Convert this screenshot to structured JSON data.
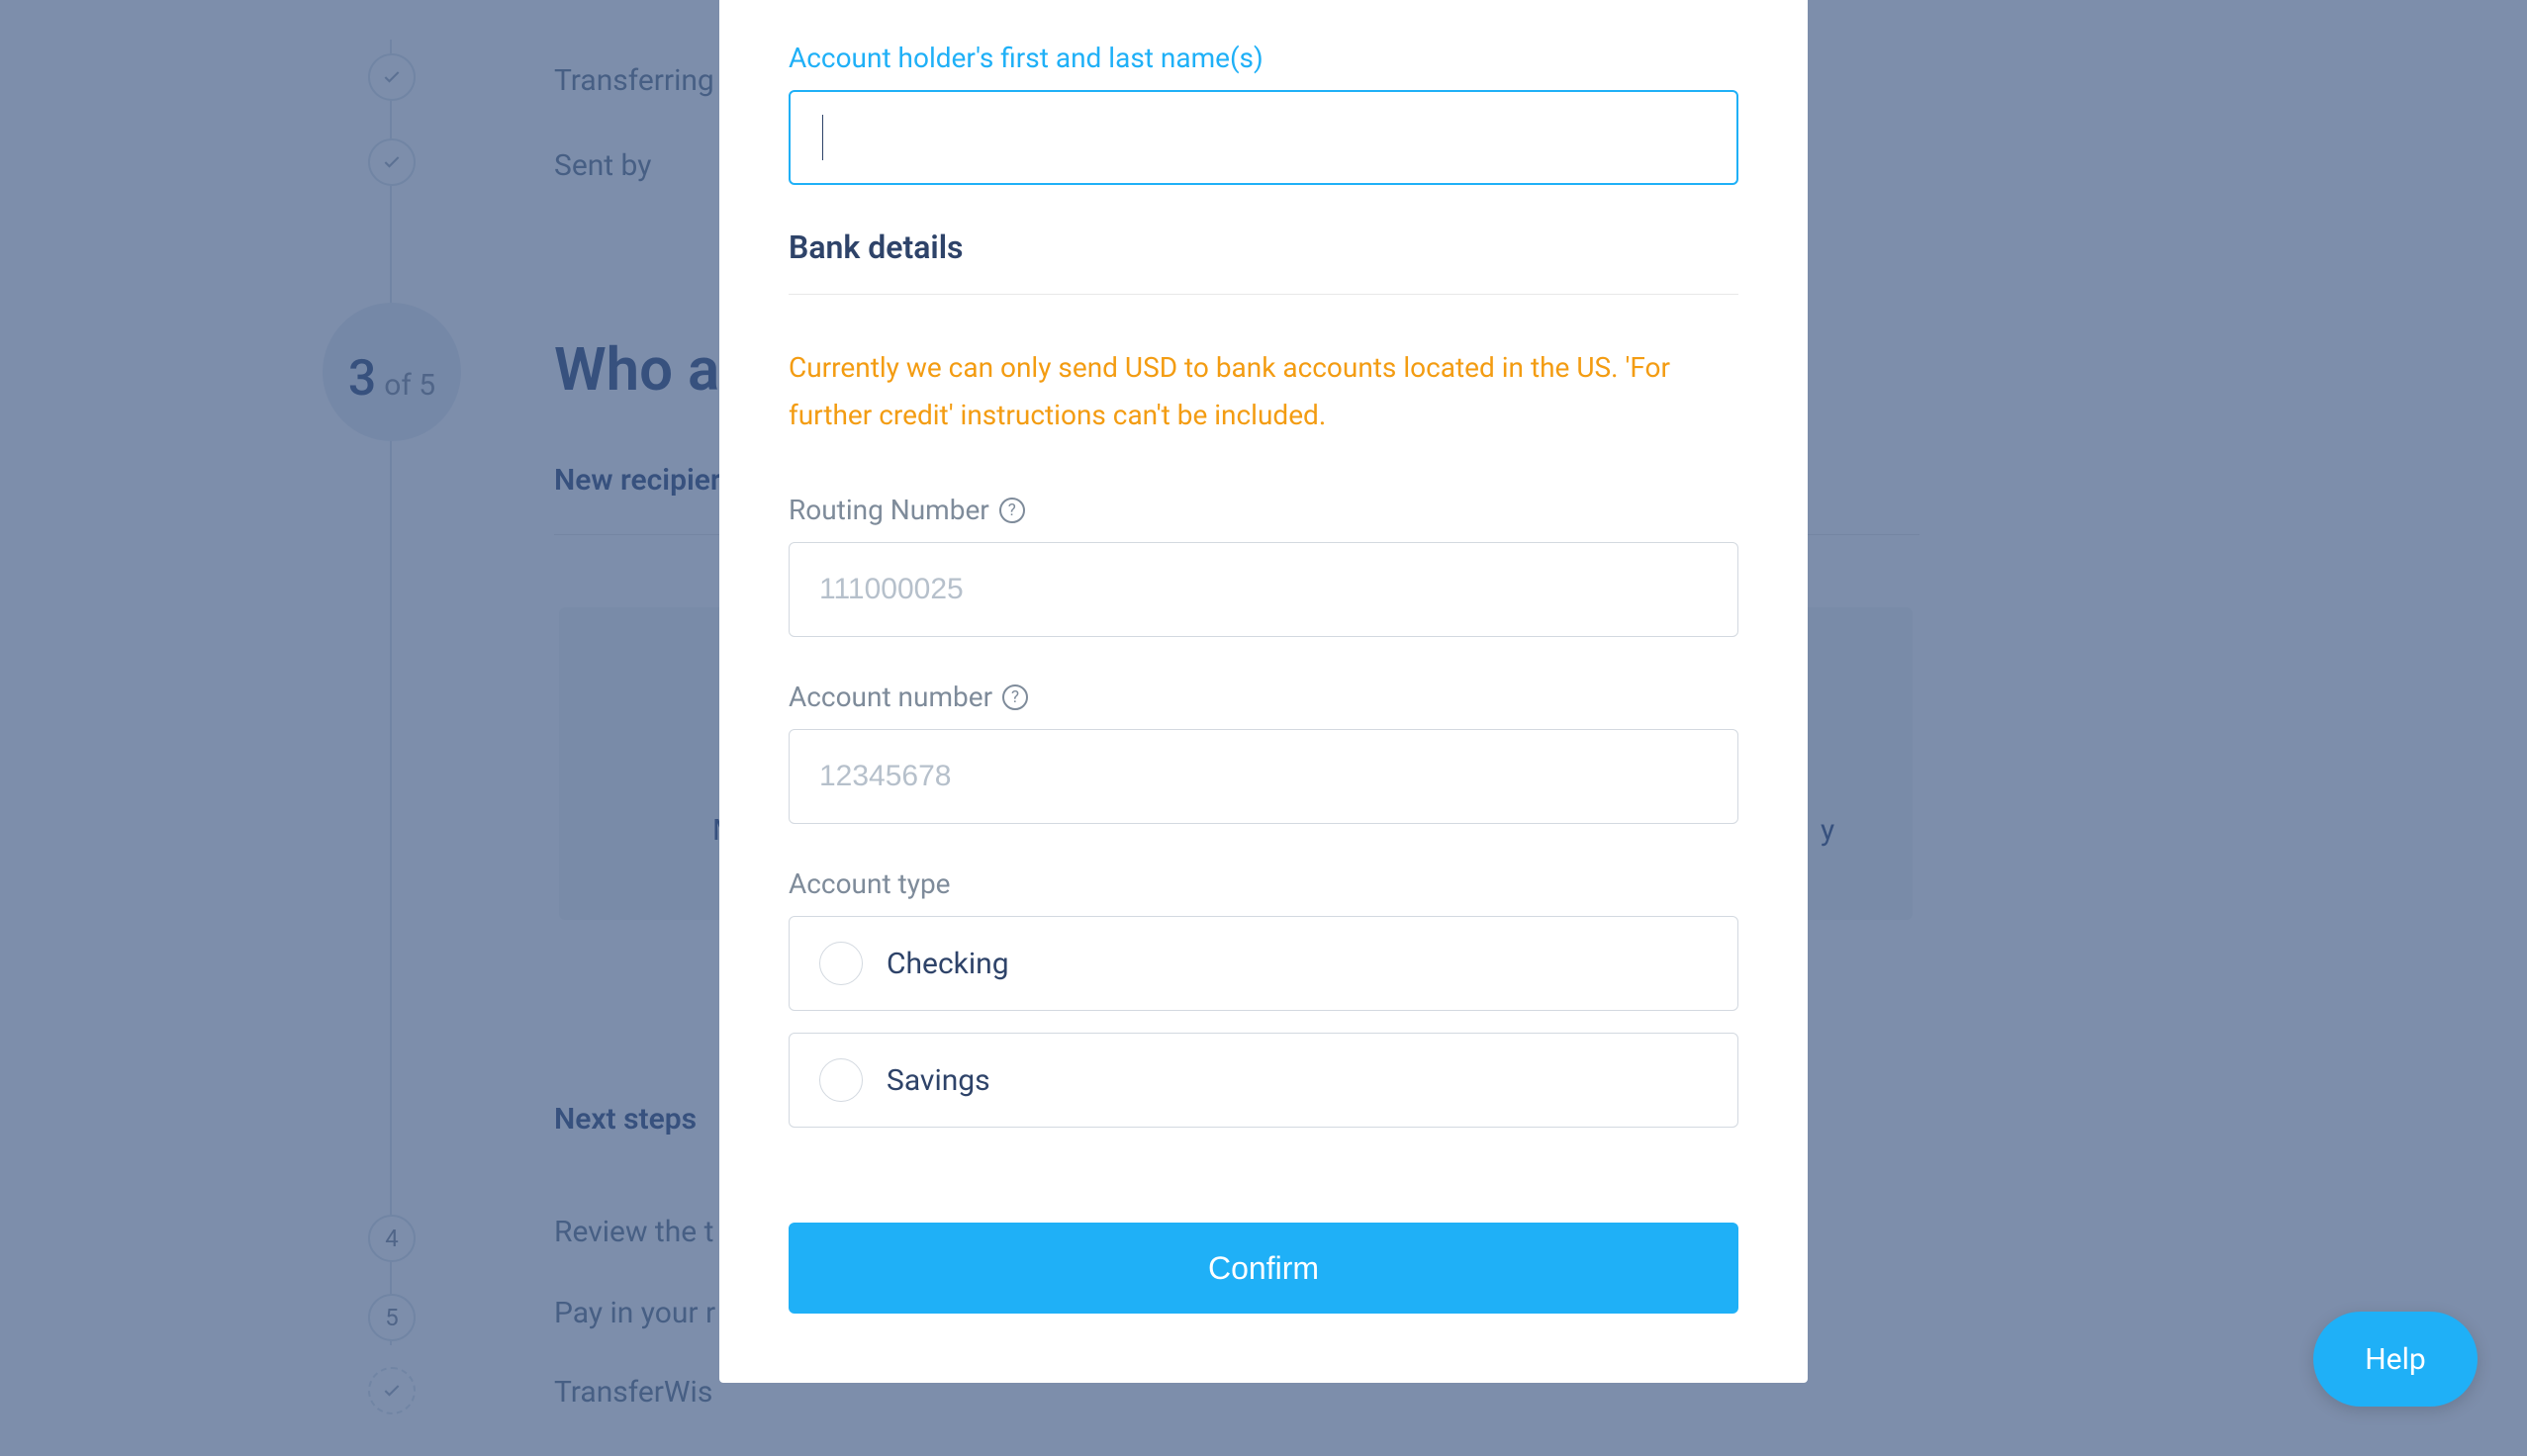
{
  "background": {
    "transferring": "Transferring",
    "sent_by": "Sent by",
    "heading": "Who ar",
    "subheading": "New recipier",
    "card_m": "M",
    "card_y": "y",
    "next_steps": "Next steps",
    "review": "Review the t",
    "pay_in": "Pay in your r",
    "transferwise": "TransferWis",
    "step_current": "3",
    "step_of": "of 5",
    "step_4": "4",
    "step_5": "5"
  },
  "modal": {
    "name_label": "Account holder's first and last name(s)",
    "name_value": "",
    "section_header": "Bank details",
    "warning": "Currently we can only send USD to bank accounts located in the US. 'For further credit' instructions can't be included.",
    "routing_label": "Routing Number",
    "routing_placeholder": "111000025",
    "routing_value": "",
    "account_number_label": "Account number",
    "account_number_placeholder": "12345678",
    "account_number_value": "",
    "account_type_label": "Account type",
    "option_checking": "Checking",
    "option_savings": "Savings",
    "confirm_button": "Confirm"
  },
  "help_button": "Help"
}
